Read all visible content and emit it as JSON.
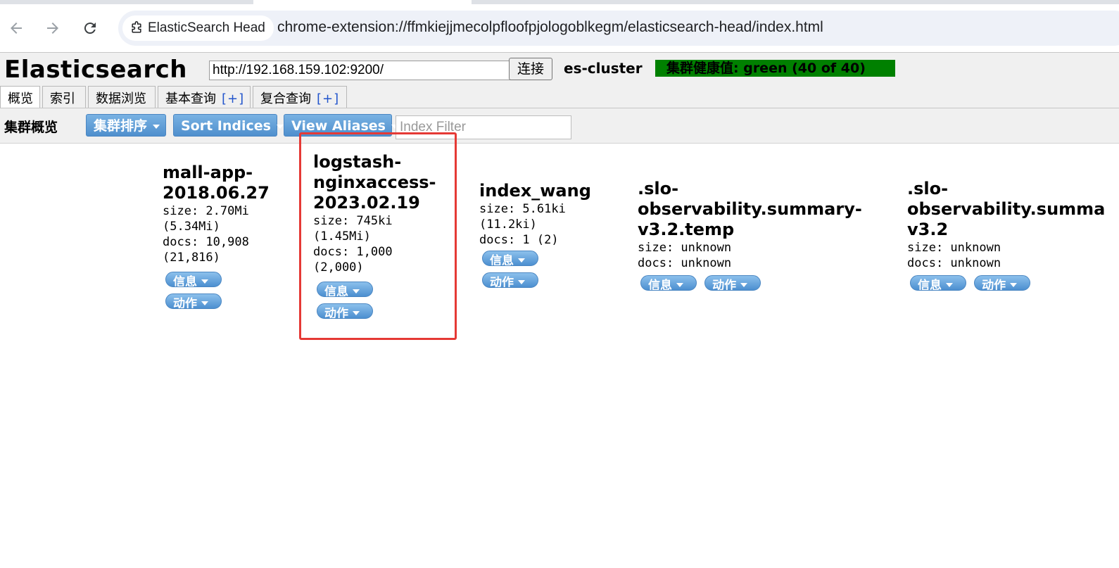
{
  "browser": {
    "tab_title": "ElasticSearch Head",
    "url": "chrome-extension://ffmkiejjmecolpfloofpjologoblkegm/elasticsearch-head/index.html",
    "icons": [
      "back-arrow-icon",
      "forward-arrow-icon",
      "reload-icon",
      "extension-icon"
    ]
  },
  "header": {
    "title": "Elasticsearch",
    "connection_url": "http://192.168.159.102:9200/",
    "connect_label": "连接",
    "cluster_name": "es-cluster",
    "health_text": "集群健康值: green (40 of 40)",
    "health_color": "#008000"
  },
  "tabs": [
    {
      "label": "概览",
      "plus": ""
    },
    {
      "label": "索引",
      "plus": ""
    },
    {
      "label": "数据浏览",
      "plus": ""
    },
    {
      "label": "基本查询",
      "plus": "[+]"
    },
    {
      "label": "复合查询",
      "plus": "[+]"
    }
  ],
  "overview": {
    "label": "集群概览",
    "sort_cluster_label": "集群排序",
    "sort_indices_label": "Sort Indices",
    "view_aliases_label": "View Aliases",
    "filter_placeholder": "Index Filter"
  },
  "indices": [
    {
      "name": "mall-app-\n2018.06.27",
      "meta": "size: 2.70Mi\n(5.34Mi)\ndocs: 10,908\n(21,816)",
      "info_label": "信息",
      "action_label": "动作"
    },
    {
      "name": "logstash-\nnginxaccess-\n2023.02.19",
      "meta": "size: 745ki\n(1.45Mi)\ndocs: 1,000\n(2,000)",
      "info_label": "信息",
      "action_label": "动作",
      "highlighted": true
    },
    {
      "name": "index_wang",
      "meta": "size: 5.61ki\n(11.2ki)\ndocs: 1 (2)",
      "info_label": "信息",
      "action_label": "动作"
    },
    {
      "name": ".slo-\nobservability.summary-\nv3.2.temp",
      "meta": "size: unknown\ndocs: unknown",
      "info_label": "信息",
      "action_label": "动作"
    },
    {
      "name": ".slo-\nobservability.summa\nv3.2",
      "meta": "size: unknown\ndocs: unknown",
      "info_label": "信息",
      "action_label": "动作"
    }
  ],
  "colors": {
    "highlight_box": "#e53935",
    "button_blue": "#4f8fcd"
  }
}
